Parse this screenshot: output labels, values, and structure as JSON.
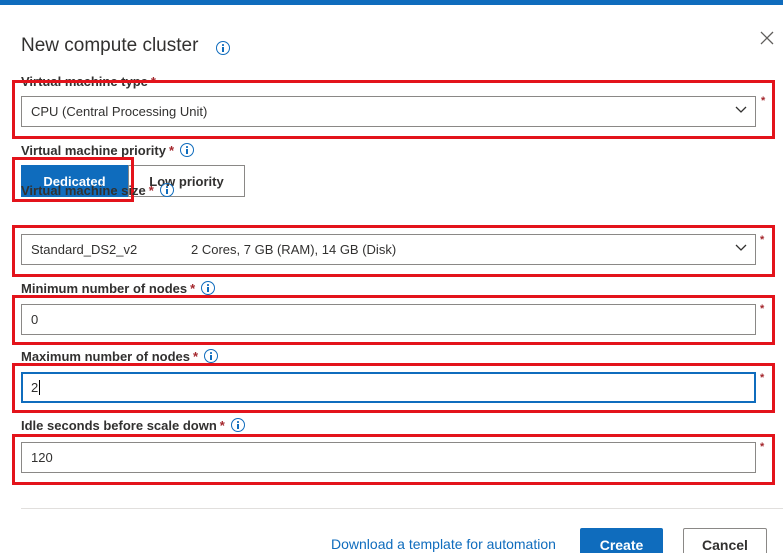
{
  "dialog": {
    "title": "New compute cluster"
  },
  "fields": {
    "vm_type": {
      "label": "Virtual machine type",
      "required_mark": "*",
      "value": "CPU (Central Processing Unit)"
    },
    "vm_priority": {
      "label": "Virtual machine priority",
      "required_mark": "*",
      "options": [
        "Dedicated",
        "Low priority"
      ],
      "selected": "Dedicated"
    },
    "vm_size": {
      "label": "Virtual machine size",
      "required_mark": "*",
      "name": "Standard_DS2_v2",
      "details": "2 Cores, 7 GB (RAM), 14 GB (Disk)"
    },
    "min_nodes": {
      "label": "Minimum number of nodes",
      "required_mark": "*",
      "value": "0"
    },
    "max_nodes": {
      "label": "Maximum number of nodes",
      "required_mark": "*",
      "value": "2"
    },
    "idle_seconds": {
      "label": "Idle seconds before scale down",
      "required_mark": "*",
      "value": "120"
    }
  },
  "footer": {
    "download_link": "Download a template for automation",
    "create_label": "Create",
    "cancel_label": "Cancel"
  },
  "icons": {
    "info": "info-circle-icon",
    "close": "close-icon",
    "chevron": "chevron-down-icon"
  },
  "colors": {
    "accent": "#0f6cbd",
    "annotation_red": "#e3131b",
    "required_red": "#a4262c"
  }
}
